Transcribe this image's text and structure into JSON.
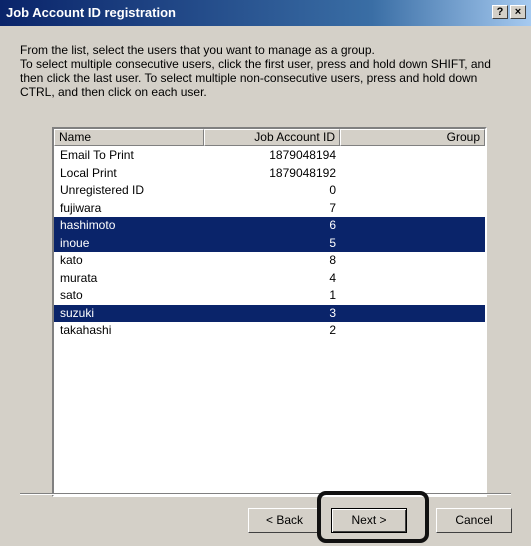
{
  "window": {
    "title": "Job Account ID registration"
  },
  "titlebar_buttons": {
    "help": "?",
    "close": "×"
  },
  "instructions": {
    "line1": "From the list, select the users that you want to manage as a group.",
    "line2": "To select multiple consecutive users, click the first user, press and hold down SHIFT, and then click the last user. To select multiple non-consecutive users, press and hold down CTRL, and then click on each user."
  },
  "list": {
    "columns": [
      "Name",
      "Job Account ID",
      "Group"
    ],
    "rows": [
      {
        "name": "Email To Print",
        "id": "1879048194",
        "selected": false
      },
      {
        "name": "Local Print",
        "id": "1879048192",
        "selected": false
      },
      {
        "name": "Unregistered ID",
        "id": "0",
        "selected": false
      },
      {
        "name": "fujiwara",
        "id": "7",
        "selected": false
      },
      {
        "name": "hashimoto",
        "id": "6",
        "selected": true
      },
      {
        "name": "inoue",
        "id": "5",
        "selected": true
      },
      {
        "name": "kato",
        "id": "8",
        "selected": false
      },
      {
        "name": "murata",
        "id": "4",
        "selected": false
      },
      {
        "name": "sato",
        "id": "1",
        "selected": false
      },
      {
        "name": "suzuki",
        "id": "3",
        "selected": true
      },
      {
        "name": "takahashi",
        "id": "2",
        "selected": false
      }
    ]
  },
  "buttons": {
    "back": "< Back",
    "next": "Next >",
    "cancel": "Cancel"
  },
  "colors": {
    "selection": "#0a246a",
    "dialog": "#d4d0c8",
    "title_start": "#0a246a",
    "title_end": "#a6caf0"
  }
}
